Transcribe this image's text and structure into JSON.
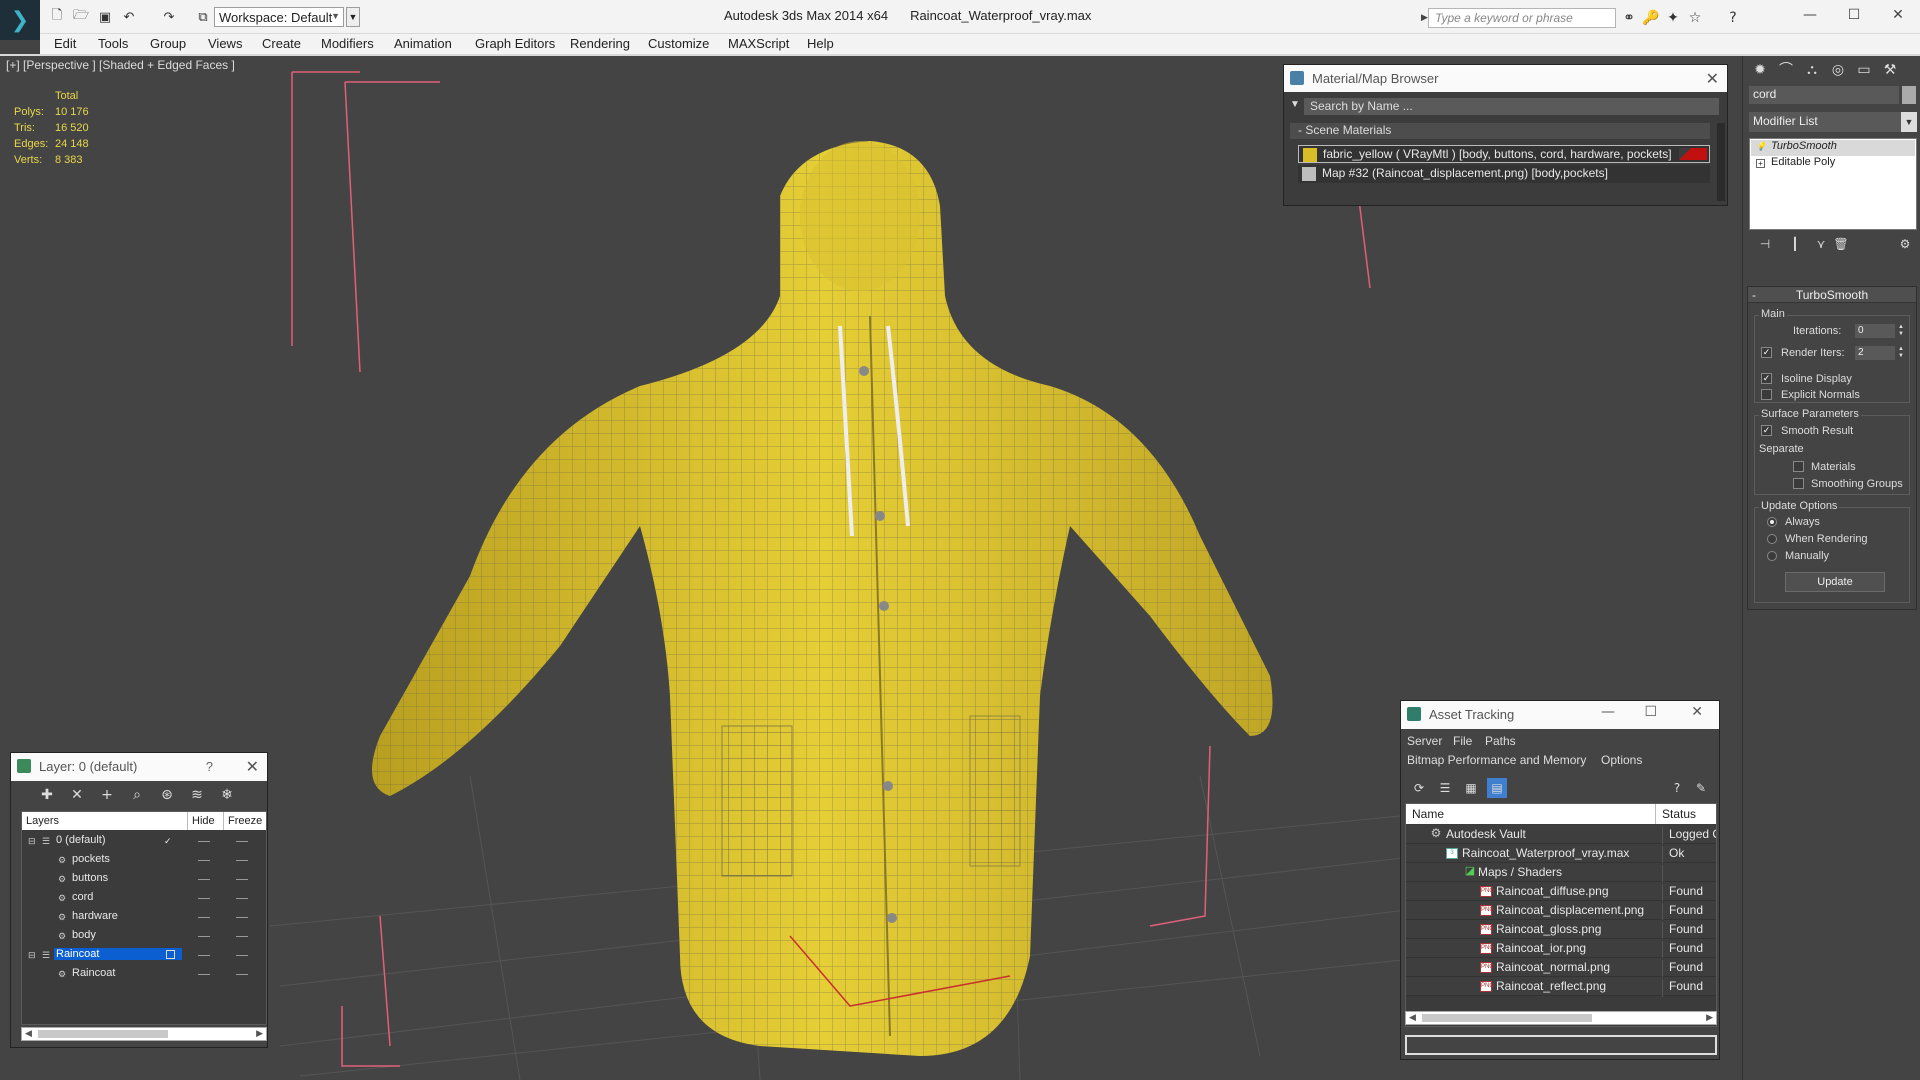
{
  "titlebar": {
    "workspace": "Workspace: Default",
    "app_name": "Autodesk 3ds Max  2014 x64",
    "file_name": "Raincoat_Waterproof_vray.max",
    "search_placeholder": "Type a keyword or phrase"
  },
  "menu": [
    "Edit",
    "Tools",
    "Group",
    "Views",
    "Create",
    "Modifiers",
    "Animation",
    "Graph Editors",
    "Rendering",
    "Customize",
    "MAXScript",
    "Help"
  ],
  "viewport": {
    "label": "[+] [Perspective ] [Shaded + Edged Faces ]",
    "stats": {
      "header": "Total",
      "rows": [
        {
          "key": "Polys:",
          "value": "10 176"
        },
        {
          "key": "Tris:",
          "value": "16 520"
        },
        {
          "key": "Edges:",
          "value": "24 148"
        },
        {
          "key": "Verts:",
          "value": "8 383"
        }
      ]
    }
  },
  "material_browser": {
    "title": "Material/Map Browser",
    "search_placeholder": "Search by Name ...",
    "section": "- Scene Materials",
    "items": [
      "fabric_yellow  ( VRayMtl ) [body, buttons, cord, hardware, pockets]",
      "Map #32 (Raincoat_displacement.png) [body,pockets]"
    ]
  },
  "command_panel": {
    "object_name": "cord",
    "modifier_list": "Modifier List",
    "stack": [
      "TurboSmooth",
      "Editable Poly"
    ],
    "turbosmooth": {
      "title": "TurboSmooth",
      "main_group": "Main",
      "iterations_label": "Iterations:",
      "iterations_value": "0",
      "render_iters_label": "Render Iters:",
      "render_iters_value": "2",
      "isoline_display": "Isoline Display",
      "explicit_normals": "Explicit Normals",
      "surface_group": "Surface Parameters",
      "smooth_result": "Smooth Result",
      "separate": "Separate",
      "materials": "Materials",
      "smoothing_groups": "Smoothing Groups",
      "update_group": "Update Options",
      "always": "Always",
      "when_rendering": "When Rendering",
      "manually": "Manually",
      "update_button": "Update"
    }
  },
  "layer_panel": {
    "title": "Layer: 0 (default)",
    "help": "?",
    "columns": [
      "Layers",
      "Hide",
      "Freeze"
    ],
    "rows": [
      {
        "name": "0 (default)"
      },
      {
        "name": "pockets"
      },
      {
        "name": "buttons"
      },
      {
        "name": "cord"
      },
      {
        "name": "hardware"
      },
      {
        "name": "body"
      },
      {
        "name": "Raincoat"
      },
      {
        "name": "Raincoat"
      }
    ]
  },
  "asset_panel": {
    "title": "Asset Tracking",
    "menus": [
      "Server",
      "File",
      "Paths"
    ],
    "menus2": [
      "Bitmap Performance and Memory",
      "Options"
    ],
    "columns": [
      "Name",
      "Status"
    ],
    "rows": [
      {
        "name": "Autodesk Vault",
        "status": "Logged Ou"
      },
      {
        "name": "Raincoat_Waterproof_vray.max",
        "status": "Ok"
      },
      {
        "name": "Maps / Shaders",
        "status": ""
      },
      {
        "name": "Raincoat_diffuse.png",
        "status": "Found"
      },
      {
        "name": "Raincoat_displacement.png",
        "status": "Found"
      },
      {
        "name": "Raincoat_gloss.png",
        "status": "Found"
      },
      {
        "name": "Raincoat_ior.png",
        "status": "Found"
      },
      {
        "name": "Raincoat_normal.png",
        "status": "Found"
      },
      {
        "name": "Raincoat_reflect.png",
        "status": "Found"
      }
    ]
  },
  "colors": {
    "viewport_bg": "#444444",
    "model_yellow": "#e4cc33",
    "stats_text": "#e8d64a",
    "bounding_box": "#e0607a",
    "selection_blue": "#0c5fd0"
  }
}
